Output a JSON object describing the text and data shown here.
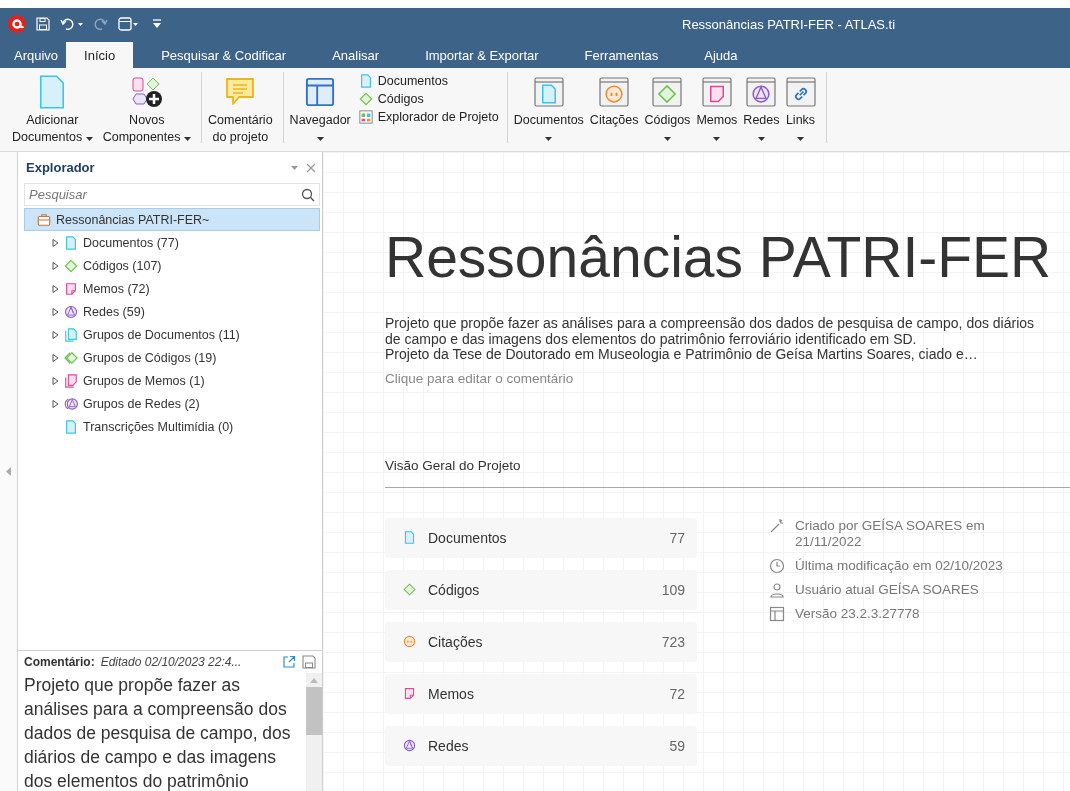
{
  "window": {
    "title": "Ressonâncias PATRI-FER - ATLAS.ti"
  },
  "tabs": [
    {
      "label": "Arquivo",
      "selected": false
    },
    {
      "label": "Início",
      "selected": true
    },
    {
      "label": "Pesquisar & Codificar",
      "selected": false
    },
    {
      "label": "Analisar",
      "selected": false
    },
    {
      "label": "Importar & Exportar",
      "selected": false
    },
    {
      "label": "Ferramentas",
      "selected": false
    },
    {
      "label": "Ajuda",
      "selected": false
    }
  ],
  "ribbon": {
    "groups": [
      {
        "kind": "large",
        "items": [
          {
            "lines": [
              "Adicionar",
              "Documentos"
            ],
            "dropdown": true
          },
          {
            "lines": [
              "Novos",
              "Componentes"
            ],
            "dropdown": true
          }
        ]
      },
      {
        "kind": "large",
        "items": [
          {
            "lines": [
              "Comentário",
              "do projeto"
            ],
            "dropdown": false
          }
        ]
      },
      {
        "kind": "navigator",
        "items": [
          {
            "lines": [
              "Navegador"
            ],
            "dropdown": true
          }
        ],
        "links": [
          {
            "label": "Documentos"
          },
          {
            "label": "Códigos"
          },
          {
            "label": "Explorador de Projeto"
          }
        ]
      },
      {
        "kind": "managers",
        "items": [
          {
            "lines": [
              "Documentos"
            ],
            "dropdown": true
          },
          {
            "lines": [
              "Citações"
            ],
            "dropdown": false
          },
          {
            "lines": [
              "Códigos"
            ],
            "dropdown": true
          },
          {
            "lines": [
              "Memos"
            ],
            "dropdown": true
          },
          {
            "lines": [
              "Redes"
            ],
            "dropdown": true
          },
          {
            "lines": [
              "Links"
            ],
            "dropdown": true
          }
        ]
      }
    ]
  },
  "explorer": {
    "title": "Explorador",
    "search": {
      "placeholder": "Pesquisar"
    },
    "tree": [
      {
        "label": "Ressonâncias PATRI-FER~",
        "kind": "project",
        "selected": true,
        "children": [
          {
            "label": "Documentos (77)",
            "kind": "document",
            "selected": false,
            "expanded": false
          },
          {
            "label": "Códigos (107)",
            "kind": "code",
            "selected": false,
            "expanded": false
          },
          {
            "label": "Memos (72)",
            "kind": "memo",
            "selected": false,
            "expanded": false
          },
          {
            "label": "Redes (59)",
            "kind": "network",
            "selected": false,
            "expanded": false
          },
          {
            "label": "Grupos de Documentos (11)",
            "kind": "document-group",
            "selected": false,
            "expanded": false
          },
          {
            "label": "Grupos de Códigos (19)",
            "kind": "code-group",
            "selected": false,
            "expanded": false
          },
          {
            "label": "Grupos de Memos (1)",
            "kind": "memo-group",
            "selected": false,
            "expanded": false
          },
          {
            "label": "Grupos de Redes (2)",
            "kind": "network-group",
            "selected": false,
            "expanded": false
          },
          {
            "label": "Transcrições Multimídia (0)",
            "kind": "document",
            "selected": false
          }
        ]
      }
    ]
  },
  "comment": {
    "label": "Comentário:",
    "edited": "Editado 02/10/2023 22:4...",
    "text": "Projeto que propõe fazer as análises para a compreensão dos dados de pesquisa de campo, dos diários de campo e das imagens dos elementos do patrimônio"
  },
  "project": {
    "title": "Ressonâncias PATRI-FER",
    "description": [
      "Projeto que propõe fazer as análises para a compreensão dos dados de pesquisa de campo, dos diários de campo e das imagens dos elementos do patrimônio ferroviário identificado em SD.",
      "Projeto da Tese de Doutorado em Museologia e Patrimônio de Geísa Martins Soares, ciado e…"
    ],
    "comment_placeholder": "Clique para editar o comentário",
    "overview_title": "Visão Geral do Projeto",
    "stats": [
      {
        "kind": "document",
        "label": "Documentos",
        "count": "77"
      },
      {
        "kind": "code",
        "label": "Códigos",
        "count": "109"
      },
      {
        "kind": "quotation",
        "label": "Citações",
        "count": "723"
      },
      {
        "kind": "memo",
        "label": "Memos",
        "count": "72"
      },
      {
        "kind": "network",
        "label": "Redes",
        "count": "59"
      }
    ],
    "info": [
      {
        "kind": "created",
        "text": "Criado por GEÍSA   SOARES em 21/11/2022"
      },
      {
        "kind": "modified",
        "text": "Última modificação em 02/10/2023"
      },
      {
        "kind": "user",
        "text": "Usuário atual GEÍSA   SOARES"
      },
      {
        "kind": "version",
        "text": "Versão 23.2.3.27778"
      }
    ]
  }
}
